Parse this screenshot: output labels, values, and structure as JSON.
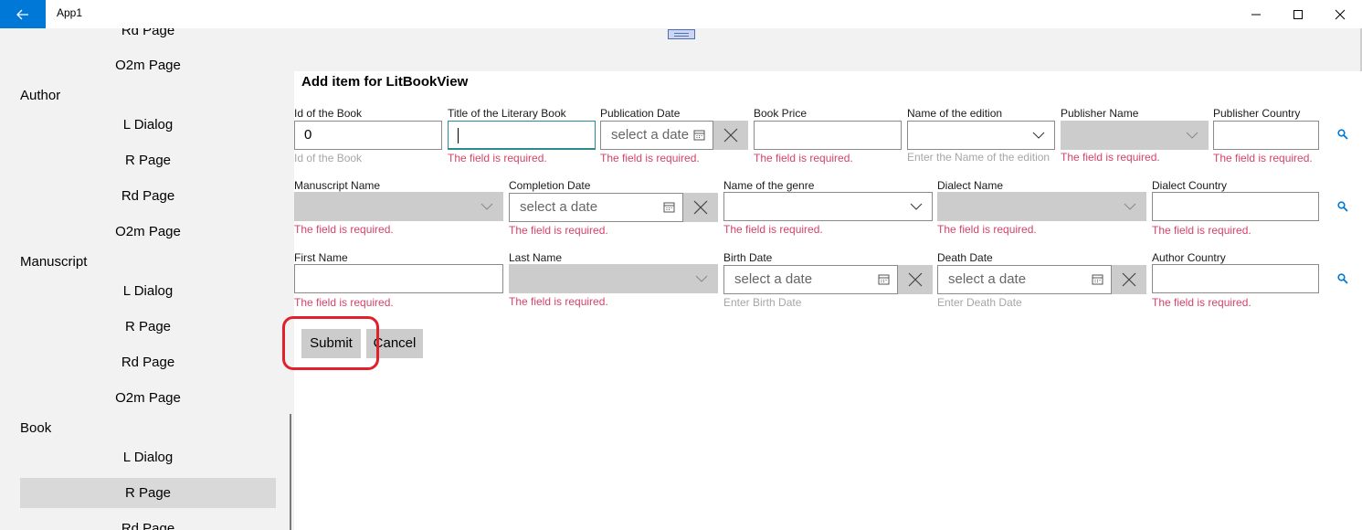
{
  "window": {
    "title": "App1"
  },
  "sidebar": {
    "items": [
      {
        "label": "Rd Page"
      },
      {
        "label": "O2m Page"
      },
      {
        "group": "Author"
      },
      {
        "label": "L Dialog"
      },
      {
        "label": "R Page"
      },
      {
        "label": "Rd Page"
      },
      {
        "label": "O2m Page"
      },
      {
        "group": "Manuscript"
      },
      {
        "label": "L Dialog"
      },
      {
        "label": "R Page"
      },
      {
        "label": "Rd Page"
      },
      {
        "label": "O2m Page"
      },
      {
        "group": "Book"
      },
      {
        "label": "L Dialog"
      },
      {
        "label": "R Page"
      },
      {
        "label": "Rd Page"
      }
    ]
  },
  "form": {
    "title": "Add item for LitBookView",
    "required": "The  field is required.",
    "date_placeholder": "select a date",
    "row1": {
      "id_label": "Id of the Book",
      "id_value": "0",
      "id_hint": "Id of the Book",
      "title_label": "Title of the Literary Book",
      "pubdate_label": "Publication Date",
      "price_label": "Book Price",
      "edition_label": "Name of the edition",
      "edition_hint": "Enter the Name of the edition",
      "publisher_label": "Publisher Name",
      "pubcountry_label": "Publisher Country"
    },
    "row2": {
      "manuscript_label": "Manuscript Name",
      "completion_label": "Completion Date",
      "genre_label": "Name of the genre",
      "dialect_label": "Dialect Name",
      "dialectcountry_label": "Dialect Country"
    },
    "row3": {
      "first_label": "First Name",
      "last_label": "Last Name",
      "birth_label": "Birth Date",
      "birth_hint": "Enter Birth Date",
      "death_label": "Death Date",
      "death_hint": "Enter Death Date",
      "authorcountry_label": "Author Country"
    },
    "submit_label": "Submit",
    "cancel_label": "Cancel"
  },
  "icons": [
    "back-arrow-icon",
    "minimize-icon",
    "maximize-icon",
    "close-icon",
    "chevron-down-icon",
    "calendar-icon",
    "clear-x-icon",
    "search-icon"
  ],
  "colors": {
    "accent": "#0078d7",
    "error": "#d4436b",
    "highlight": "#e0202a"
  }
}
